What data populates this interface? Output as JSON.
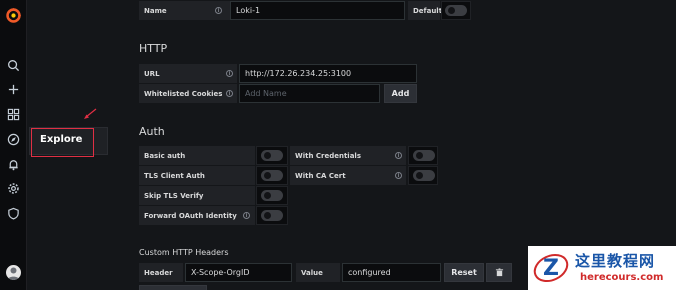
{
  "sidebar": {
    "icons": [
      "grafana-logo-icon",
      "search-icon",
      "plus-icon",
      "dashboards-icon",
      "explore-compass-icon",
      "alerting-bell-icon",
      "configuration-gear-icon",
      "server-admin-shield-icon",
      "user-avatar-icon"
    ],
    "flyout_label": "Explore"
  },
  "settings": {
    "name_label": "Name",
    "name_value": "Loki-1",
    "default_label": "Default"
  },
  "http": {
    "title": "HTTP",
    "url_label": "URL",
    "url_value": "http://172.26.234.25:3100",
    "cookies_label": "Whitelisted Cookies",
    "cookies_placeholder": "Add Name",
    "add_button": "Add"
  },
  "auth": {
    "title": "Auth",
    "basic_auth": "Basic auth",
    "with_credentials": "With Credentials",
    "tls_client_auth": "TLS Client Auth",
    "with_ca_cert": "With CA Cert",
    "skip_tls_verify": "Skip TLS Verify",
    "forward_oauth": "Forward OAuth Identity"
  },
  "custom_headers": {
    "title": "Custom HTTP Headers",
    "header_label": "Header",
    "header_value": "X-Scope-OrgID",
    "value_label": "Value",
    "value_value": "configured",
    "reset_button": "Reset"
  },
  "watermark": {
    "cn": "这里教程网",
    "url": "herecours.com"
  },
  "colors": {
    "background": "#141619",
    "highlight": "#e02f44",
    "watermark_blue": "#1a56a8",
    "watermark_red": "#d02a2a"
  }
}
